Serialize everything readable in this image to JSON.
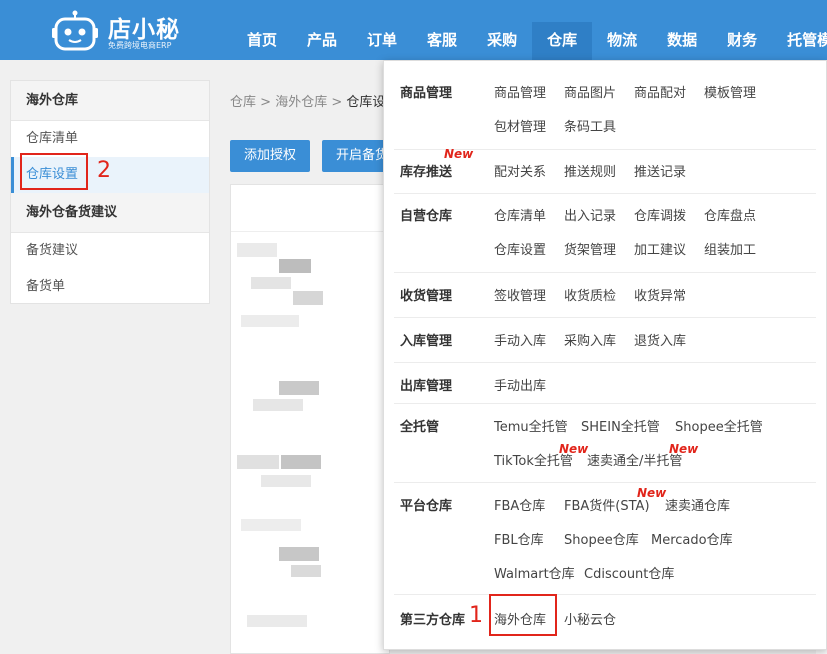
{
  "logo": {
    "title": "店小秘",
    "subtitle": "免费跨境电商ERP"
  },
  "nav": [
    "首页",
    "产品",
    "订单",
    "客服",
    "采购",
    "仓库",
    "物流",
    "数据",
    "财务",
    "托管模"
  ],
  "sidebar": {
    "group1": "海外仓库",
    "items1": [
      "仓库清单",
      "仓库设置"
    ],
    "group2": "海外仓备货建议",
    "items2": [
      "备货建议",
      "备货单"
    ]
  },
  "breadcrumb": {
    "a": "仓库",
    "sep": ">",
    "b": "海外仓库",
    "c": "仓库设"
  },
  "buttons": {
    "add_auth": "添加授权",
    "open_stock": "开启备货"
  },
  "dropdown": {
    "goods": {
      "title": "商品管理",
      "links": [
        "商品管理",
        "商品图片",
        "商品配对",
        "模板管理",
        "包材管理",
        "条码工具"
      ]
    },
    "push": {
      "title": "库存推送",
      "links": [
        "配对关系",
        "推送规则",
        "推送记录"
      ]
    },
    "self": {
      "title": "自营仓库",
      "links": [
        "仓库清单",
        "出入记录",
        "仓库调拨",
        "仓库盘点",
        "仓库设置",
        "货架管理",
        "加工建议",
        "组装加工"
      ]
    },
    "receive": {
      "title": "收货管理",
      "links": [
        "签收管理",
        "收货质检",
        "收货异常"
      ]
    },
    "inbound": {
      "title": "入库管理",
      "links": [
        "手动入库",
        "采购入库",
        "退货入库"
      ]
    },
    "outbound": {
      "title": "出库管理",
      "links": [
        "手动出库"
      ]
    },
    "full": {
      "title": "全托管",
      "links": [
        "Temu全托管",
        "SHEIN全托管",
        "Shopee全托管",
        "TikTok全托管",
        "速卖通全/半托管"
      ]
    },
    "platform": {
      "title": "平台仓库",
      "links": [
        "FBA仓库",
        "FBA货件(STA)",
        "速卖通仓库",
        "FBL仓库",
        "Shopee仓库",
        "Mercado仓库",
        "Walmart仓库",
        "Cdiscount仓库"
      ]
    },
    "third": {
      "title": "第三方仓库",
      "links": [
        "海外仓库",
        "小秘云仓"
      ]
    },
    "new_label": "New"
  },
  "annotations": {
    "step1": "1",
    "step2": "2"
  },
  "colors": {
    "primary": "#3a8ed6",
    "accent_red": "#e1251b"
  }
}
